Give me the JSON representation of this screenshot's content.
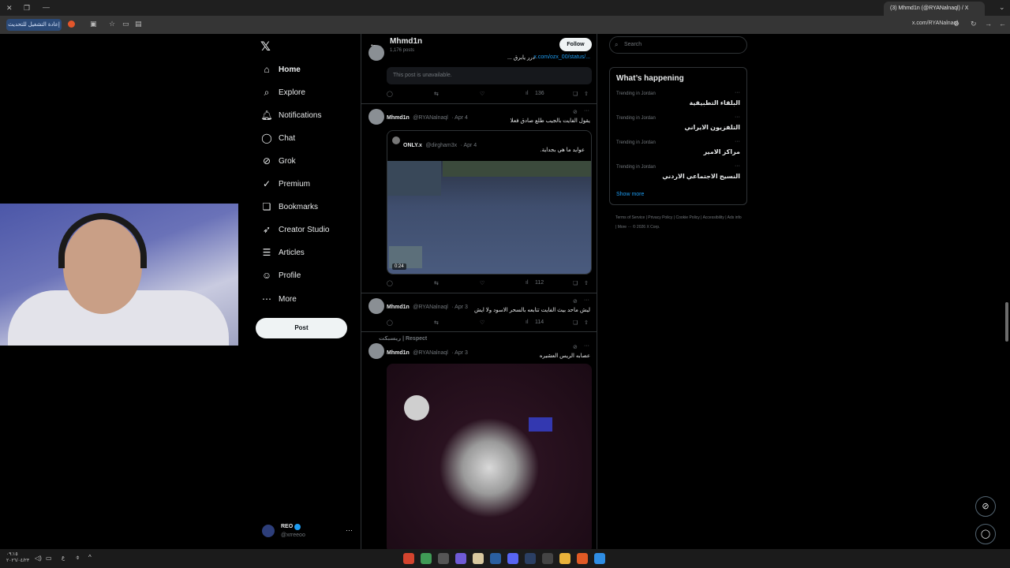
{
  "browser": {
    "tab_title": "(3) Mhmd1n (@RYANalnaql) / X",
    "url": "x.com/RYANalnaql",
    "update_button": "إعادة التشغيل للتحديث"
  },
  "nav": {
    "items": [
      {
        "label": "Home",
        "icon": "home-icon"
      },
      {
        "label": "Explore",
        "icon": "search-icon"
      },
      {
        "label": "Notifications",
        "icon": "bell-icon"
      },
      {
        "label": "Chat",
        "icon": "chat-icon"
      },
      {
        "label": "Grok",
        "icon": "grok-icon"
      },
      {
        "label": "Premium",
        "icon": "premium-icon"
      },
      {
        "label": "Bookmarks",
        "icon": "bookmark-icon"
      },
      {
        "label": "Creator Studio",
        "icon": "rocket-icon"
      },
      {
        "label": "Articles",
        "icon": "article-icon"
      },
      {
        "label": "Profile",
        "icon": "person-icon"
      },
      {
        "label": "More",
        "icon": "more-circle-icon"
      }
    ],
    "post_label": "Post",
    "account": {
      "name": "REO",
      "handle": "@xrreeoo"
    }
  },
  "profile_header": {
    "name": "Mhmd1n",
    "posts_count": "1,176 posts",
    "follow_label": "Follow"
  },
  "posts": [
    {
      "text": "درر يابرق ...",
      "link": "x.com/ozx_00/status/...",
      "unavailable": "This post is unavailable.",
      "views": "136"
    },
    {
      "name": "Mhmd1n",
      "handle": "@RYANalnaql",
      "date": "· Apr 4",
      "text": "يقول الفايت بالجيب طلع صادق فعلا",
      "quote": {
        "name": "ONLY.x",
        "handle": "@dirgham3x",
        "date": "· Apr 4",
        "text": "عوايد ما هي بجداية.",
        "video_time": "0:24"
      },
      "views": "112"
    },
    {
      "name": "Mhmd1n",
      "handle": "@RYANalnaql",
      "date": "· Apr 3",
      "text": "ليش ماحد بيث الفايت تتابعه بالسحر الاسود ولا ايش",
      "views": "114"
    },
    {
      "repost_label": "ريسبكت | Respect",
      "name": "Mhmd1n",
      "handle": "@RYANalnaql",
      "date": "· Apr 3",
      "text": "عصابه الريس العشيره"
    }
  ],
  "sidebar": {
    "search_placeholder": "Search",
    "whats_happening": "What’s happening",
    "trends": [
      {
        "meta": "Trending in Jordan",
        "name": "البلقاء التطبيقية"
      },
      {
        "meta": "Trending in Jordan",
        "name": "التلفزيون الايراني"
      },
      {
        "meta": "Trending in Jordan",
        "name": "مراكز الامير"
      },
      {
        "meta": "Trending in Jordan",
        "name": "النسيج الاجتماعي الاردني"
      }
    ],
    "show_more": "Show more",
    "footer": "Terms of Service | Privacy Policy | Cookie Policy | Accessibility | Ads info | More ··· © 2026 X Corp."
  },
  "colors": {
    "accent": "#1d9bf0",
    "background": "#000000",
    "border": "#2f3336",
    "muted": "#71767b"
  }
}
